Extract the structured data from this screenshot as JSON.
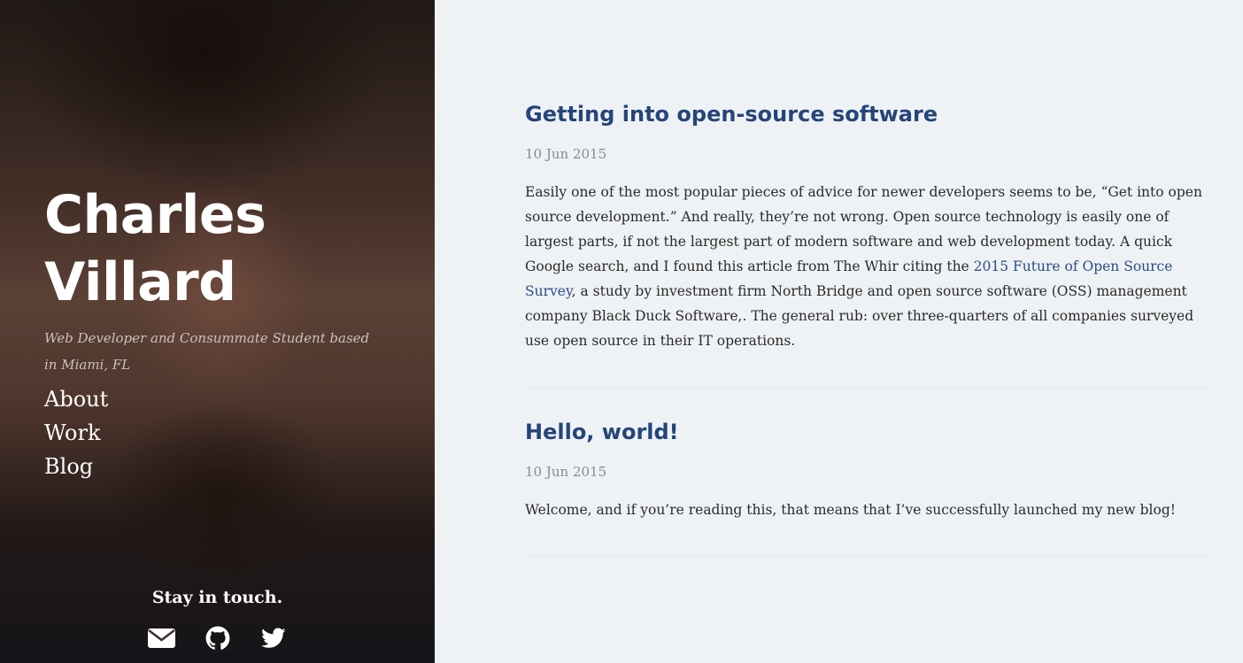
{
  "sidebar": {
    "title_line1": "Charles",
    "title_line2": "Villard",
    "tagline": "Web Developer and Consummate Student based in Miami, FL",
    "nav": [
      {
        "label": "About"
      },
      {
        "label": "Work"
      },
      {
        "label": "Blog"
      }
    ],
    "stay_in_touch": "Stay in touch.",
    "social_icons": [
      "envelope-icon",
      "github-icon",
      "twitter-icon"
    ],
    "background_image": "portrait-photo"
  },
  "posts": [
    {
      "title": "Getting into open-source software",
      "date": "10 Jun 2015",
      "body_before_link": "Easily one of the most popular pieces of advice for newer developers seems to be, “Get into open source development.” And really, they’re not wrong. Open source technology is easily one of largest parts, if not the largest part of modern software and web development today. A quick Google search, and I found this article from The Whir citing the ",
      "link_text": "2015 Future of Open Source Survey",
      "body_after_link": ", a study by investment firm North Bridge and open source software (OSS) management company Black Duck Software,. The general rub: over three-quarters of all companies surveyed use open source in their IT operations."
    },
    {
      "title": "Hello, world!",
      "date": "10 Jun 2015",
      "body": "Welcome, and if you’re reading this, that means that I’ve successfully launched my new blog!"
    }
  ],
  "colors": {
    "main_background": "#eff2f5",
    "post_title": "#25457a",
    "link": "#2a4c8a",
    "date": "#8a8a8a",
    "body_text": "#2a2a2a"
  }
}
